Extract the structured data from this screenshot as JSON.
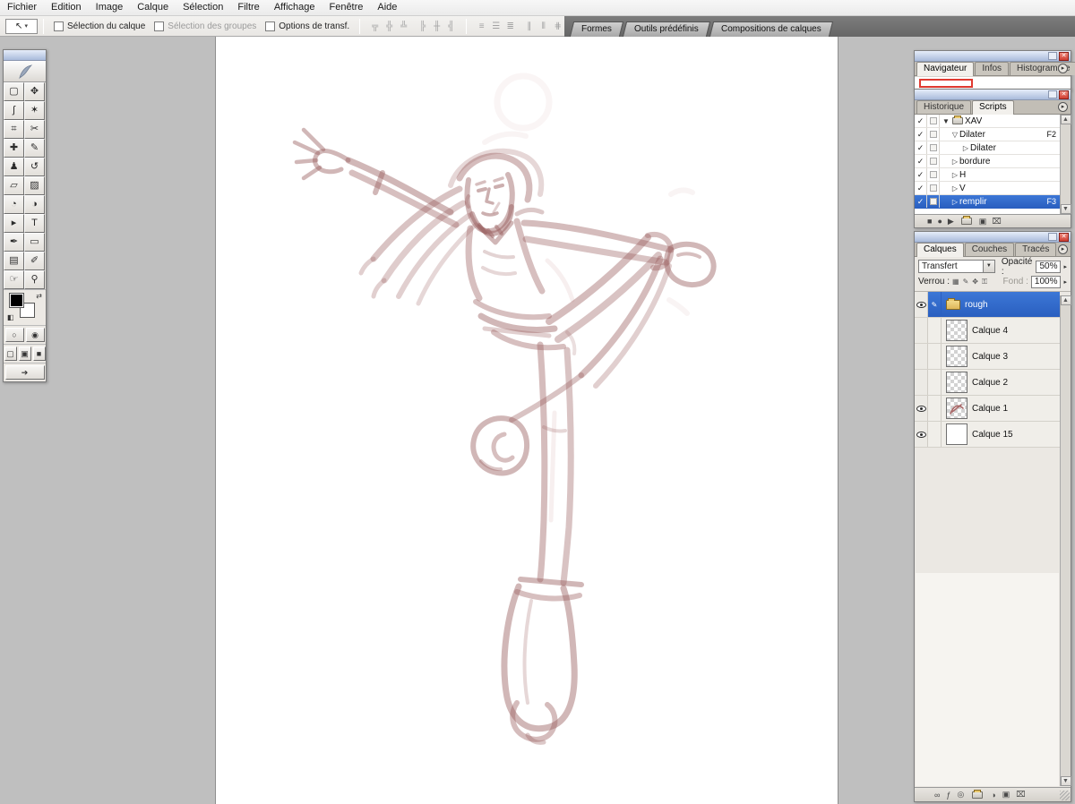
{
  "icons": {
    "close": "✕",
    "panel_menu": "▸",
    "up_arrow": "▲",
    "down_arrow": "▼",
    "combo_arrow": "▼",
    "spinner": "▸",
    "check": "✓",
    "tool_dropdown": "▾",
    "move_tool": "↖",
    "palette_toggle": "✎",
    "swap_arrow": "⇄",
    "mini_swatch": "◧"
  },
  "menu_bar": {
    "items": [
      "Fichier",
      "Edition",
      "Image",
      "Calque",
      "Sélection",
      "Filtre",
      "Affichage",
      "Fenêtre",
      "Aide"
    ]
  },
  "options_bar": {
    "checkbox_layer": "Sélection du calque",
    "checkbox_groups": "Sélection des groupes",
    "checkbox_transform": "Options de transf.",
    "align_icons": [
      "╦",
      "╬",
      "╩",
      "╠",
      "╫",
      "╣"
    ],
    "distribute_icons": [
      "≡",
      "☰",
      "≣",
      "∥",
      "⫴",
      "⋕"
    ],
    "palette_tabs": [
      "Formes",
      "Outils prédéfinis",
      "Compositions de calques"
    ]
  },
  "toolbox": {
    "tools": [
      {
        "name": "rectangular-marquee",
        "glyph": "▢"
      },
      {
        "name": "move",
        "glyph": "✥"
      },
      {
        "name": "lasso",
        "glyph": "ʃ"
      },
      {
        "name": "magic-wand",
        "glyph": "✶"
      },
      {
        "name": "crop",
        "glyph": "⌗"
      },
      {
        "name": "slice",
        "glyph": "✂"
      },
      {
        "name": "healing-brush",
        "glyph": "✚"
      },
      {
        "name": "brush",
        "glyph": "✎"
      },
      {
        "name": "clone-stamp",
        "glyph": "♟"
      },
      {
        "name": "history-brush",
        "glyph": "↺"
      },
      {
        "name": "eraser",
        "glyph": "▱"
      },
      {
        "name": "gradient",
        "glyph": "▨"
      },
      {
        "name": "blur",
        "glyph": "◔"
      },
      {
        "name": "dodge",
        "glyph": "◑"
      },
      {
        "name": "path-selection",
        "glyph": "▸"
      },
      {
        "name": "type",
        "glyph": "T"
      },
      {
        "name": "pen",
        "glyph": "✒"
      },
      {
        "name": "shape",
        "glyph": "▭"
      },
      {
        "name": "notes",
        "glyph": "▤"
      },
      {
        "name": "eyedropper",
        "glyph": "✐"
      },
      {
        "name": "hand",
        "glyph": "☞"
      },
      {
        "name": "zoom",
        "glyph": "⚲"
      }
    ],
    "quickmask_glyphs": [
      "○",
      "◉"
    ],
    "screen_mode_glyphs": [
      "▢",
      "▣",
      "■"
    ],
    "imageready_glyph": "➔"
  },
  "navigator_panel": {
    "tabs": [
      "Navigateur",
      "Infos",
      "Histogramme"
    ]
  },
  "actions_panel": {
    "tabs": [
      "Historique",
      "Scripts"
    ],
    "items": [
      {
        "check": "✓",
        "twisty": "▼",
        "label": "XAV",
        "fkey": ""
      },
      {
        "check": "✓",
        "twisty": "▽",
        "label": "Dilater",
        "fkey": "F2"
      },
      {
        "check": "✓",
        "twisty": "▷",
        "label": "Dilater",
        "fkey": ""
      },
      {
        "check": "✓",
        "twisty": "▷",
        "label": "bordure",
        "fkey": ""
      },
      {
        "check": "✓",
        "twisty": "▷",
        "label": "H",
        "fkey": ""
      },
      {
        "check": "✓",
        "twisty": "▷",
        "label": "V",
        "fkey": ""
      },
      {
        "check": "✓",
        "twisty": "▷",
        "label": "remplir",
        "fkey": "F3"
      }
    ],
    "footer": {
      "stop": "■",
      "record": "●",
      "play": "▶",
      "new_action": "▣",
      "delete": "⌧"
    }
  },
  "layers_panel": {
    "tabs": [
      "Calques",
      "Couches",
      "Tracés"
    ],
    "blend_mode": "Transfert",
    "opacity_label": "Opacité :",
    "opacity_value": "50%",
    "lock_label": "Verrou :",
    "lock_icons": [
      "▦",
      "✎",
      "✥",
      "⚿"
    ],
    "fill_label": "Fond :",
    "fill_value": "100%",
    "layers": [
      {
        "name": "rough",
        "visible": true,
        "type": "group",
        "selected": true
      },
      {
        "name": "Calque 4",
        "visible": false,
        "type": "layer",
        "thumb": "checker"
      },
      {
        "name": "Calque 3",
        "visible": false,
        "type": "layer",
        "thumb": "checker"
      },
      {
        "name": "Calque 2",
        "visible": false,
        "type": "layer",
        "thumb": "checker"
      },
      {
        "name": "Calque 1",
        "visible": true,
        "type": "layer",
        "thumb": "checker-sketch"
      },
      {
        "name": "Calque 15",
        "visible": true,
        "type": "layer",
        "thumb": "white"
      }
    ],
    "footer_icons": {
      "link": "∞",
      "style": "ƒ",
      "mask": "◎",
      "adjustment": "◑",
      "new_layer": "▣",
      "delete": "⌧"
    }
  },
  "colors": {
    "selection_blue": "#2e66cc",
    "sketch_stroke": "#9a6060",
    "workspace_gray": "#bfbfbf",
    "palette_well_gray": "#6f6f6f",
    "close_button_red": "#cf3d31"
  }
}
